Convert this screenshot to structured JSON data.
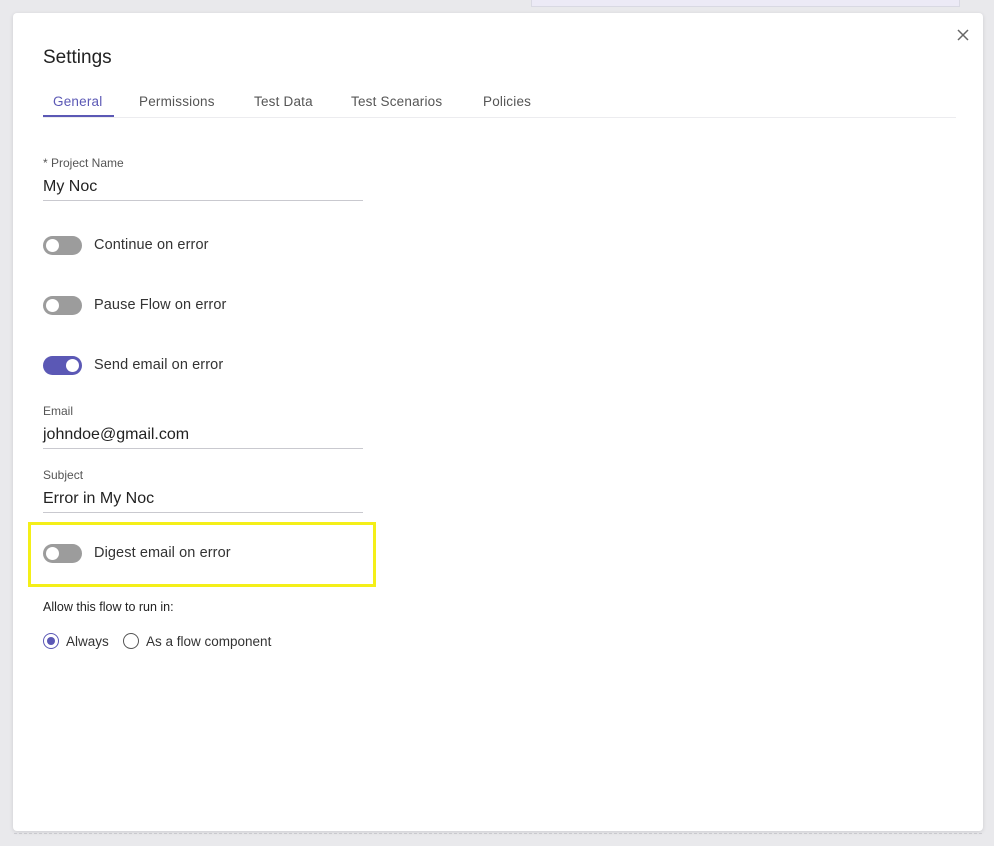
{
  "dialog": {
    "title": "Settings",
    "close_icon": "close-icon"
  },
  "tabs": [
    {
      "label": "General",
      "active": true
    },
    {
      "label": "Permissions",
      "active": false
    },
    {
      "label": "Test Data",
      "active": false
    },
    {
      "label": "Test Scenarios",
      "active": false
    },
    {
      "label": "Policies",
      "active": false
    }
  ],
  "form": {
    "project_name": {
      "label": "* Project Name",
      "value": "My Noc"
    },
    "continue_on_error": {
      "label": "Continue on error",
      "on": false
    },
    "pause_flow_on_error": {
      "label": "Pause Flow on error",
      "on": false
    },
    "send_email_on_error": {
      "label": "Send email on error",
      "on": true
    },
    "email": {
      "label": "Email",
      "value": "johndoe@gmail.com"
    },
    "subject": {
      "label": "Subject",
      "value": "Error in My Noc"
    },
    "digest_email_on_error": {
      "label": "Digest email on error",
      "on": false
    },
    "run_in": {
      "label": "Allow this flow to run in:",
      "options": [
        {
          "label": "Always",
          "selected": true
        },
        {
          "label": "As a flow component",
          "selected": false
        }
      ]
    }
  },
  "colors": {
    "accent": "#5b58b5",
    "toggle_off": "#9c9c9c",
    "highlight": "#f4ef18"
  }
}
